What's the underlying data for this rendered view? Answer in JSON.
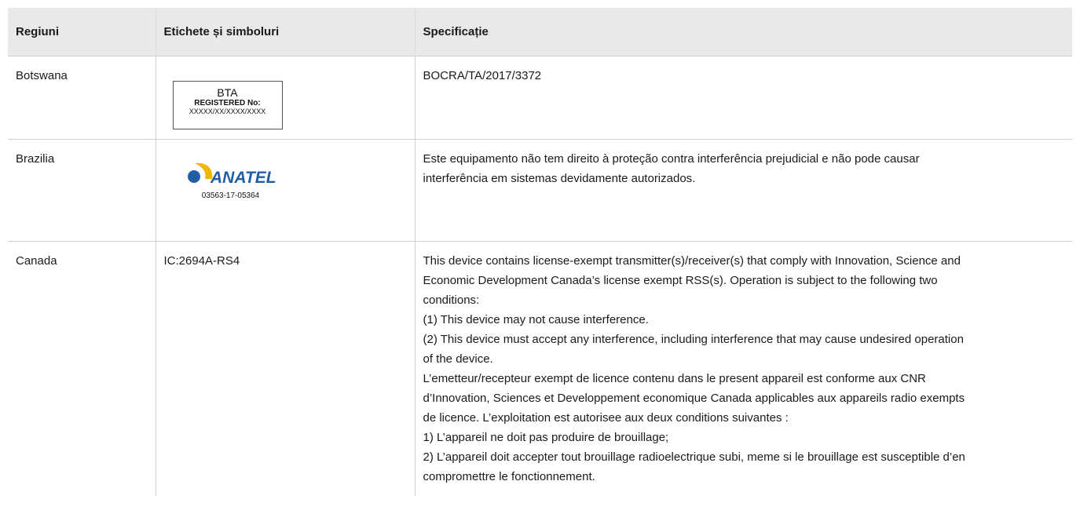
{
  "table": {
    "headers": [
      "Regiuni",
      "Etichete și simboluri",
      "Specificație"
    ],
    "rows": {
      "botswana": {
        "region": "Botswana",
        "label": {
          "title": "BTA",
          "registered": "REGISTERED No:",
          "number": "XXXXX/XX/XXXX/XXXX"
        },
        "spec": "BOCRA/TA/2017/3372"
      },
      "brazil": {
        "region": "Brazilia",
        "label": {
          "brand": "ANATEL",
          "number": "03563-17-05364",
          "brand_colors": {
            "blue": "#1f5fa8",
            "yellow": "#f2b705"
          }
        },
        "spec": [
          "Este equipamento não tem direito à proteção contra interferência prejudicial e não pode causar",
          "interferência em sistemas devidamente autorizados."
        ]
      },
      "canada": {
        "region": "Canada",
        "label": "IC:2694A-RS4",
        "spec": [
          "This device contains license-exempt transmitter(s)/receiver(s) that comply with Innovation, Science and",
          "Economic Development Canada’s license exempt RSS(s). Operation is subject to the following two",
          "conditions:",
          "(1) This device may not cause interference.",
          "(2) This device must accept any interference, including interference that may cause undesired operation",
          "of the device.",
          "L’emetteur/recepteur exempt de licence contenu dans le present appareil est conforme aux CNR",
          "d’Innovation, Sciences et Developpement economique Canada applicables aux appareils radio exempts",
          "de licence. L’exploitation est autorisee aux deux conditions suivantes :",
          "1) L’appareil ne doit pas produire de brouillage;",
          "2) L’appareil doit accepter tout brouillage radioelectrique subi, meme si le brouillage est susceptible d’en",
          "compromettre le fonctionnement."
        ]
      }
    }
  }
}
